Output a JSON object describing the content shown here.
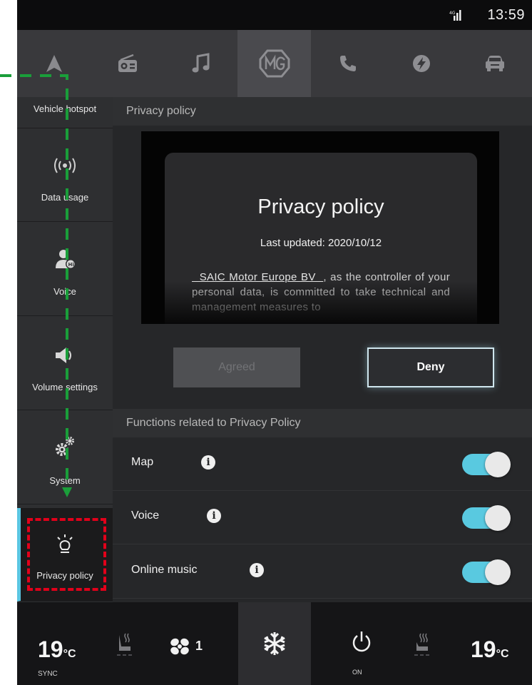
{
  "status_bar": {
    "time": "13:59"
  },
  "top_nav": {
    "items": [
      "navigation",
      "radio",
      "music",
      "mg",
      "phone",
      "charging",
      "vehicle"
    ],
    "active": "mg"
  },
  "sidebar": {
    "items": [
      {
        "label": "Vehicle hotspot",
        "icon": "hotspot-icon"
      },
      {
        "label": "Data usage",
        "icon": "wireless-icon"
      },
      {
        "label": "Voice",
        "icon": "voice-user-icon"
      },
      {
        "label": "Volume settings",
        "icon": "speaker-icon"
      },
      {
        "label": "System",
        "icon": "gears-icon"
      },
      {
        "label": "Privacy policy",
        "icon": "lightbulb-icon"
      }
    ],
    "active_index": 5
  },
  "privacy_section": {
    "header": "Privacy policy",
    "card": {
      "title": "Privacy policy",
      "last_updated": "Last updated: 2020/10/12",
      "company_link": "  SAIC Motor Europe BV  ",
      "body": ", as the controller of your personal data, is committed to take technical and management measures to"
    },
    "agreed_label": "Agreed",
    "deny_label": "Deny"
  },
  "functions_section": {
    "header": "Functions related to Privacy Policy",
    "items": [
      {
        "label": "Map",
        "enabled": true
      },
      {
        "label": "Voice",
        "enabled": true
      },
      {
        "label": "Online music",
        "enabled": true
      }
    ]
  },
  "climate": {
    "left_temp": "19",
    "right_temp": "19",
    "unit": "°C",
    "sync_label": "SYNC",
    "fan_level": "1",
    "power_label": "ON"
  },
  "colors": {
    "accent": "#59c9e0",
    "highlight_box": "#e2001a",
    "guide_line": "#1a9e3a"
  }
}
